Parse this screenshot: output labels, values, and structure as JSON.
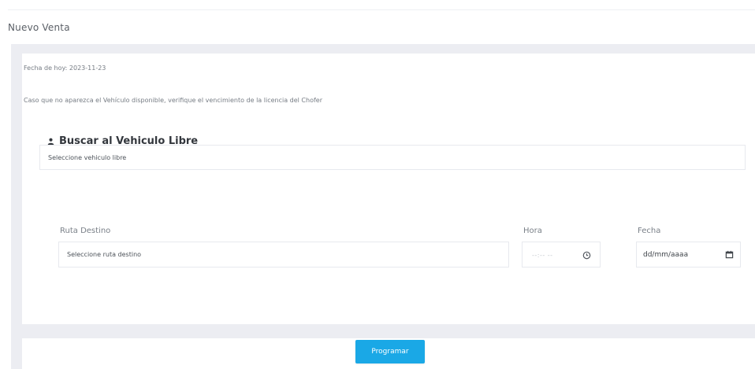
{
  "header": {
    "title": "Nuevo Venta"
  },
  "info": {
    "date_line": "Fecha de hoy: 2023-11-23",
    "notice": "Caso que no aparezca el Vehículo disponible, verifique el vencimiento de la licencia del Chofer"
  },
  "section": {
    "title": "Buscar al Vehiculo Libre",
    "vehicle_select": "Seleccione vehiculo libre"
  },
  "form": {
    "route_label": "Ruta Destino",
    "route_select": "Seleccione ruta destino",
    "time_label": "Hora",
    "time_placeholder": "--:-- --",
    "date_label": "Fecha",
    "date_placeholder": "dd/mm/aaaa"
  },
  "actions": {
    "submit_label": "Programar"
  },
  "colors": {
    "accent": "#1aa8e6",
    "panel_bg": "#ecedf2"
  },
  "icons": {
    "section_icon": "user-icon",
    "time_icon": "clock-icon",
    "date_icon": "calendar-icon"
  }
}
